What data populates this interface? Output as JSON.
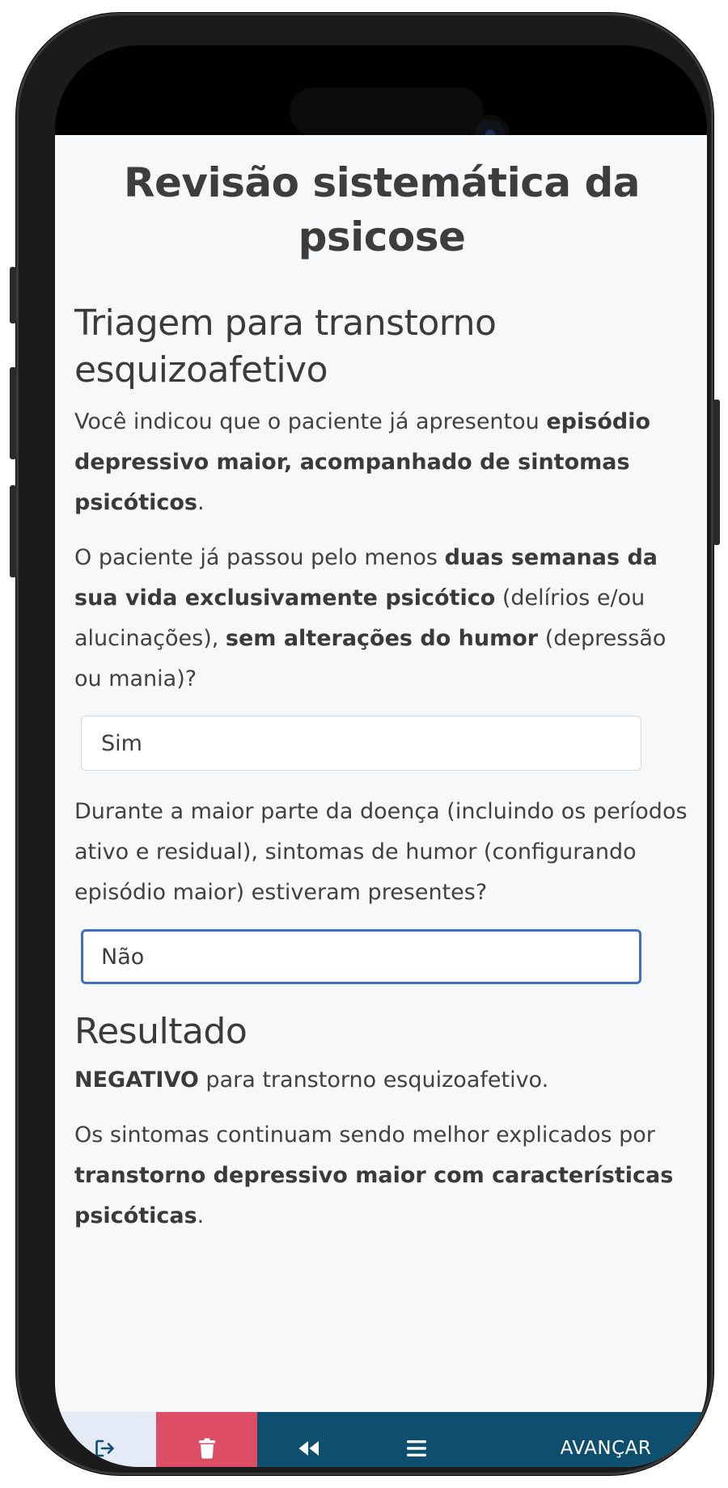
{
  "page_title": "Revisão sistemática da psicose",
  "section_title": "Triagem para transtorno esquizoafetivo",
  "intro": {
    "t1": "Você indicou que o paciente já apresentou ",
    "b1": "episódio depressivo maior, acompanhado de sintomas psicóticos",
    "t2": "."
  },
  "question1": {
    "t1": "O paciente já passou pelo menos ",
    "b1": "duas semanas da sua vida exclusivamente psicótico",
    "t2": " (delírios e/ou alucinações), ",
    "b2": "sem alterações do humor",
    "t3": " (depressão ou mania)?",
    "answer": "Sim"
  },
  "question2": {
    "text": "Durante a maior parte da doença (incluindo os períodos ativo e residual), sintomas de humor (configurando episódio maior) estiveram presentes?",
    "answer": "Não"
  },
  "result": {
    "title": "Resultado",
    "b1": "NEGATIVO",
    "t1": " para transtorno esquizoafetivo.",
    "t2": "Os sintomas continuam sendo melhor explicados por ",
    "b2": "transtorno depressivo maior com características psicóticas",
    "t3": "."
  },
  "bottom_bar": {
    "next_label": "AVANÇAR",
    "icons": [
      "exit-icon",
      "trash-icon",
      "rewind-icon",
      "menu-icon"
    ]
  },
  "colors": {
    "bar": "#0e4e6f",
    "exit_bg": "#e4eaf6",
    "trash_bg": "#de4d66",
    "focus_border": "#3d6fc2"
  }
}
